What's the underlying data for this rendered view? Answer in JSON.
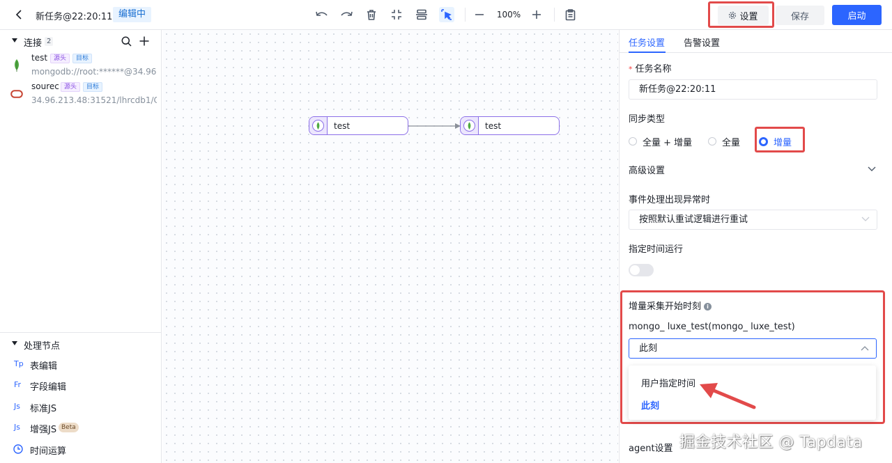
{
  "header": {
    "task_title": "新任务@22:20:11",
    "status_badge": "编辑中",
    "zoom": "100%",
    "settings_label": "设置",
    "save_label": "保存",
    "start_label": "启动"
  },
  "sidebar": {
    "connections": {
      "title": "连接",
      "count": "2",
      "items": [
        {
          "name": "test",
          "source_tag": "源头",
          "target_tag": "目标",
          "uri": "mongodb://root:******@34.96...",
          "icon": "mongodb-leaf-icon"
        },
        {
          "name": "sourec",
          "source_tag": "源头",
          "target_tag": "目标",
          "uri": "34.96.213.48:31521/lhrcdb1/C...",
          "icon": "oracle-icon"
        }
      ]
    },
    "processing": {
      "title": "处理节点",
      "items": [
        {
          "icon_text": "Tp",
          "label": "表编辑"
        },
        {
          "icon_text": "Fr",
          "label": "字段编辑"
        },
        {
          "icon_text": "Js",
          "label": "标准JS"
        },
        {
          "icon_text": "Js",
          "label": "增强JS",
          "badge": "Beta"
        },
        {
          "icon_text": "",
          "label": "时间运算",
          "icon": "clock-icon"
        }
      ]
    }
  },
  "canvas": {
    "nodes": [
      {
        "label": "test"
      },
      {
        "label": "test"
      }
    ]
  },
  "panel": {
    "tabs": [
      "任务设置",
      "告警设置"
    ],
    "task_name_label": "任务名称",
    "task_name_value": "新任务@22:20:11",
    "sync_type_label": "同步类型",
    "sync_options": [
      "全量 + 增量",
      "全量",
      "增量"
    ],
    "sync_selected": "增量",
    "advanced_label": "高级设置",
    "event_error_label": "事件处理出现异常时",
    "event_error_value": "按照默认重试逻辑进行重试",
    "scheduled_label": "指定时间运行",
    "incremental_start_label": "增量采集开始时刻",
    "connection_label": "mongo_ luxe_test(mongo_ luxe_test)",
    "start_select_value": "此刻",
    "dropdown_options": [
      "用户指定时间",
      "此刻"
    ],
    "agent_label": "agent设置"
  },
  "watermark": "掘金技术社区 @ Tapdata",
  "colors": {
    "accent": "#2c65ff",
    "highlight": "#e24a4a",
    "node_border": "#8b6fe8"
  }
}
